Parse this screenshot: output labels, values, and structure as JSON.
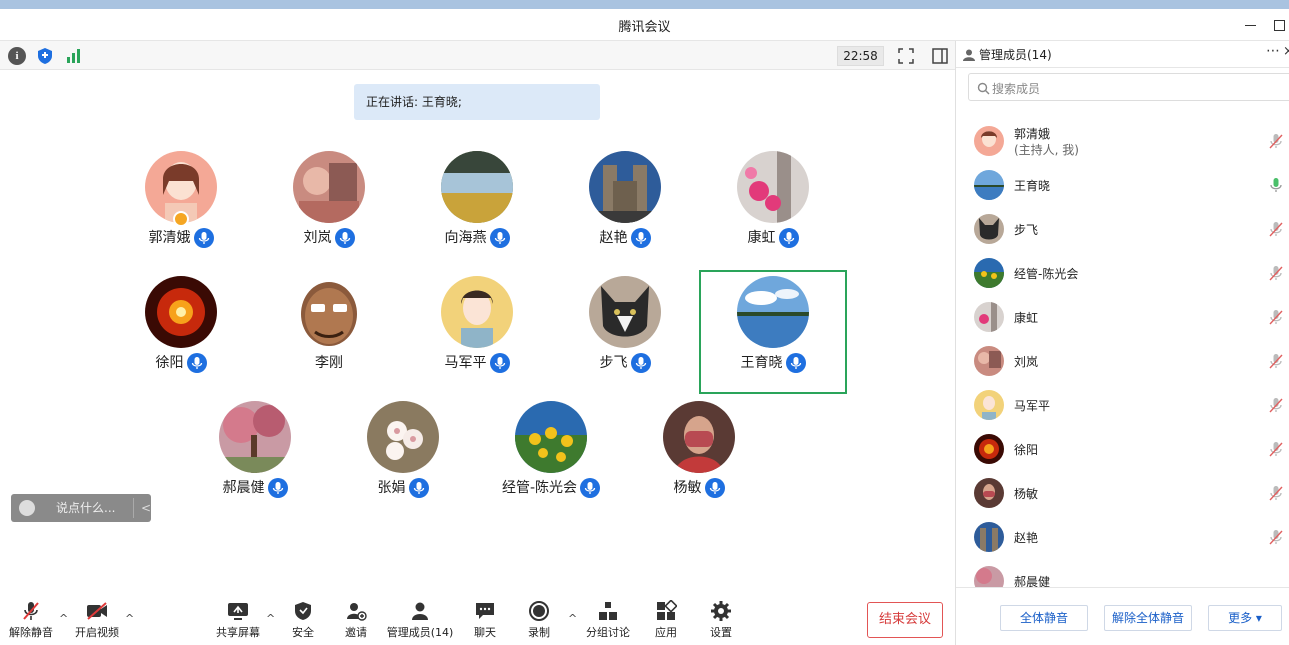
{
  "window": {
    "title": "腾讯会议"
  },
  "toolbar": {
    "time": "22:58"
  },
  "speaking": {
    "text": "正在讲话: 王育晓;"
  },
  "participants": [
    {
      "name": "郭清娥",
      "host": true
    },
    {
      "name": "刘岚"
    },
    {
      "name": "向海燕"
    },
    {
      "name": "赵艳"
    },
    {
      "name": "康虹"
    },
    {
      "name": "徐阳"
    },
    {
      "name": "李刚"
    },
    {
      "name": "马军平"
    },
    {
      "name": "步飞"
    },
    {
      "name": "王育晓",
      "active": true
    },
    {
      "name": "郝晨健"
    },
    {
      "name": "张娟"
    },
    {
      "name": "经管-陈光会"
    },
    {
      "name": "杨敏"
    }
  ],
  "chat": {
    "placeholder": "说点什么...",
    "collapse": "<"
  },
  "bottom": {
    "unmute": "解除静音",
    "video": "开启视频",
    "share": "共享屏幕",
    "security": "安全",
    "invite": "邀请",
    "members": "管理成员(14)",
    "chat": "聊天",
    "record": "录制",
    "breakout": "分组讨论",
    "apps": "应用",
    "settings": "设置",
    "end": "结束会议"
  },
  "side": {
    "title": "管理成员(14)",
    "search_placeholder": "搜索成员",
    "members": [
      {
        "name": "郭清娥",
        "sub": "(主持人, 我)",
        "mic": "muted"
      },
      {
        "name": "王育晓",
        "mic": "on"
      },
      {
        "name": "步飞",
        "mic": "muted"
      },
      {
        "name": "经管-陈光会",
        "mic": "muted"
      },
      {
        "name": "康虹",
        "mic": "muted"
      },
      {
        "name": "刘岚",
        "mic": "muted"
      },
      {
        "name": "马军平",
        "mic": "muted"
      },
      {
        "name": "徐阳",
        "mic": "muted"
      },
      {
        "name": "杨敏",
        "mic": "muted"
      },
      {
        "name": "赵艳",
        "mic": "muted"
      },
      {
        "name": "郝晨健"
      }
    ],
    "mute_all": "全体静音",
    "unmute_all": "解除全体静音",
    "more": "更多 ▾"
  },
  "colors": {
    "accent": "#1e6fe0",
    "active_border": "#2aa45a",
    "end": "#d63b3b"
  }
}
